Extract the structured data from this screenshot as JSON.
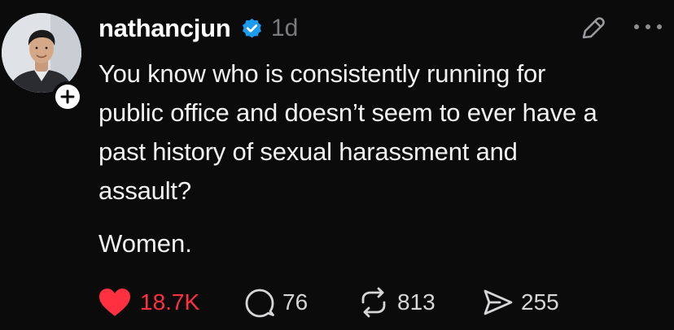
{
  "post": {
    "author": {
      "username": "nathancjun",
      "verified": true,
      "avatar_icon": "profile-photo",
      "follow_icon": "plus-icon"
    },
    "timestamp": "1d",
    "body_lines": [
      "You know who is consistently running for",
      "public office and doesn’t seem to ever have a",
      "past history of sexual harassment and",
      "assault?"
    ],
    "punchline": "Women.",
    "actions": {
      "like": {
        "icon": "heart-icon",
        "count": "18.7K",
        "liked": true
      },
      "reply": {
        "icon": "speech-bubble-icon",
        "count": "76"
      },
      "repost": {
        "icon": "repost-icon",
        "count": "813"
      },
      "share": {
        "icon": "send-icon",
        "count": "255"
      }
    },
    "header_actions": {
      "edit_icon": "pencil-icon",
      "more_icon": "ellipsis-icon"
    }
  },
  "colors": {
    "background": "#0b0b0c",
    "text": "#f1f1f1",
    "muted": "#7b7b7f",
    "verified": "#1d9bf0",
    "like": "#ff3040"
  }
}
